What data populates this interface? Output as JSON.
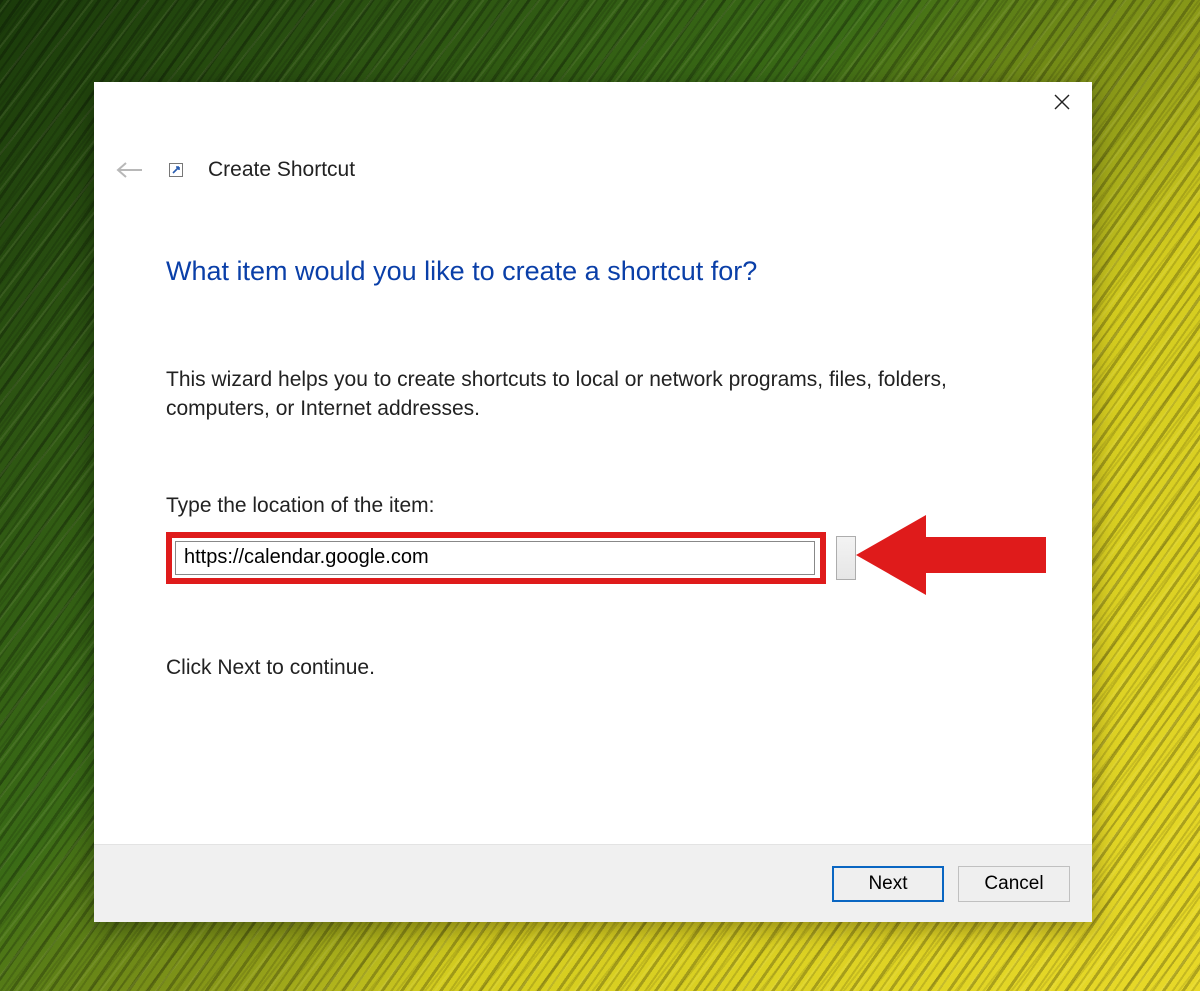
{
  "dialog": {
    "title": "Create Shortcut",
    "heading": "What item would you like to create a shortcut for?",
    "description": "This wizard helps you to create shortcuts to local or network programs, files, folders, computers, or Internet addresses.",
    "location_label": "Type the location of the item:",
    "location_value": "https://calendar.google.com",
    "continue_hint": "Click Next to continue.",
    "next_label": "Next",
    "cancel_label": "Cancel"
  }
}
